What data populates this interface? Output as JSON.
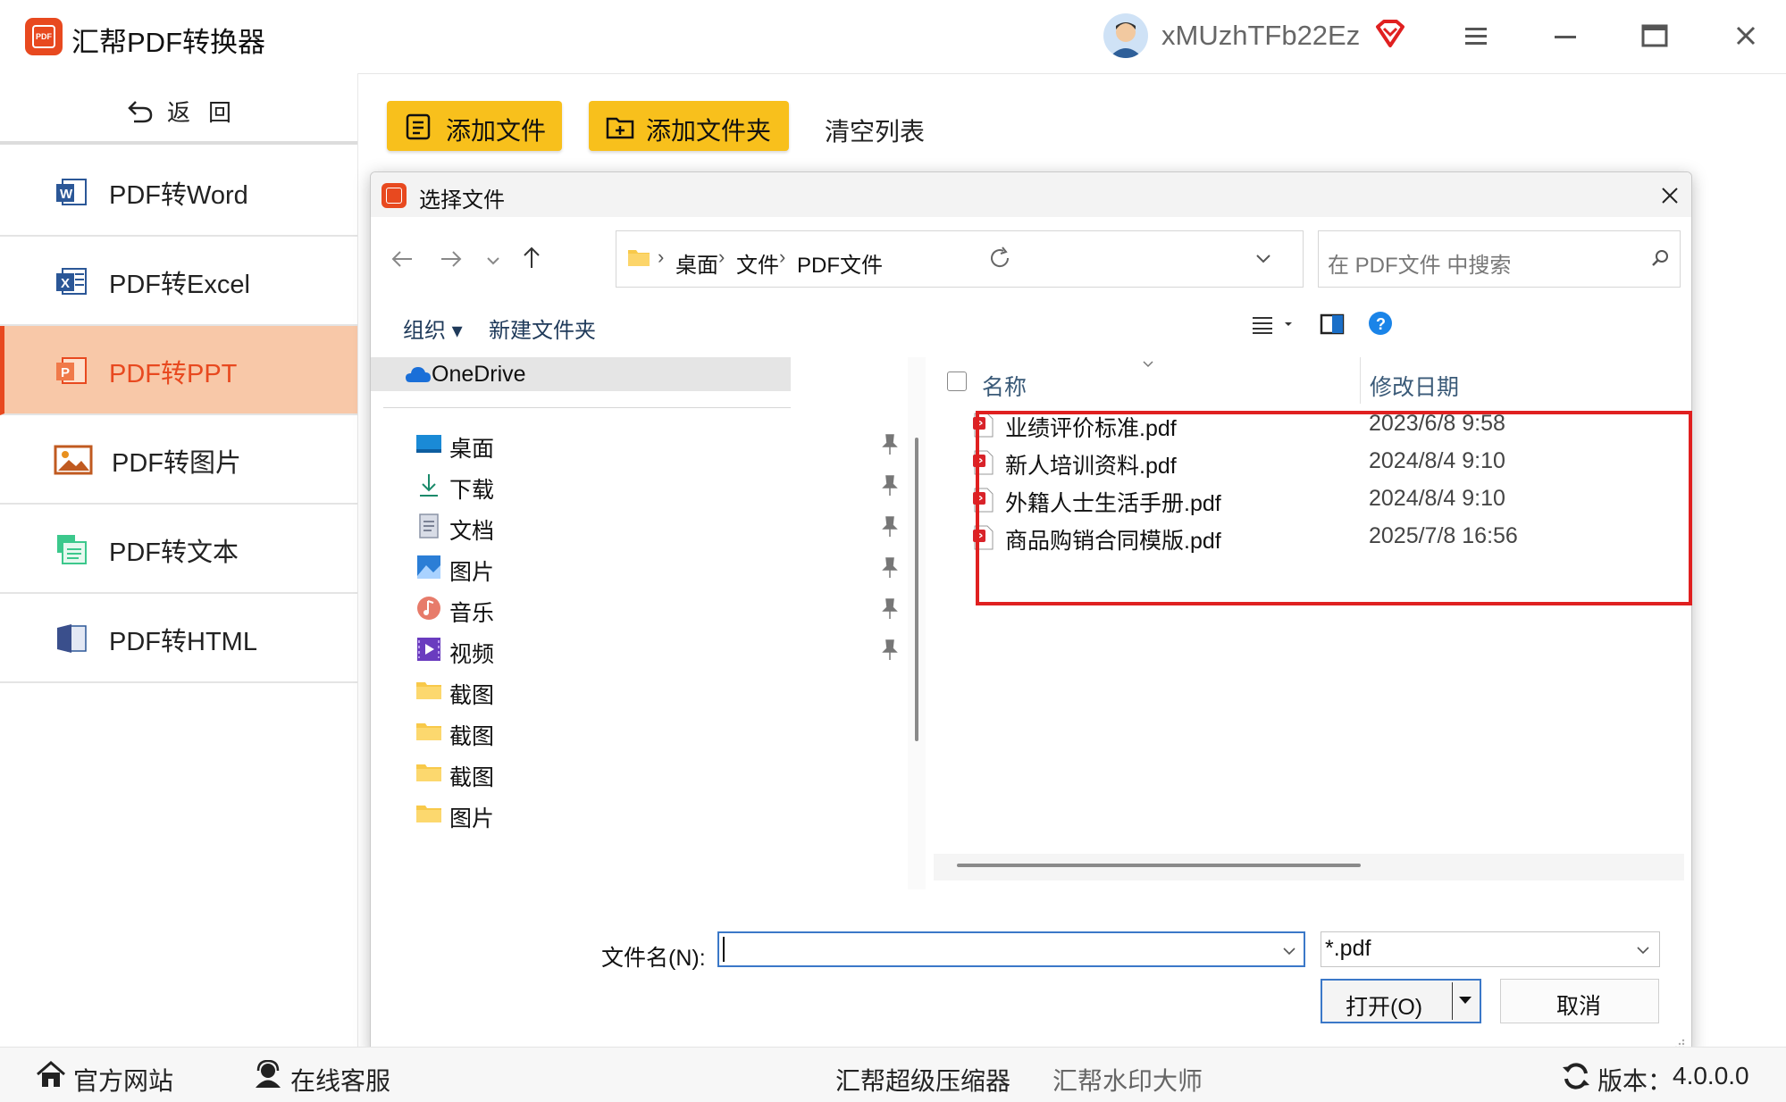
{
  "app": {
    "title": "汇帮PDF转换器",
    "logo_text": "PDF",
    "username": "xMUzhTFb22Ez",
    "accent_color": "#e8491f",
    "button_color": "#f8c01c",
    "highlight_color": "#e02020"
  },
  "sidebar": {
    "back_label": "返回",
    "items": [
      {
        "label": "PDF转Word",
        "icon": "word-icon",
        "active": false
      },
      {
        "label": "PDF转Excel",
        "icon": "excel-icon",
        "active": false
      },
      {
        "label": "PDF转PPT",
        "icon": "ppt-icon",
        "active": true
      },
      {
        "label": "PDF转图片",
        "icon": "image-icon",
        "active": false
      },
      {
        "label": "PDF转文本",
        "icon": "text-icon",
        "active": false
      },
      {
        "label": "PDF转HTML",
        "icon": "html-icon",
        "active": false
      }
    ]
  },
  "toolbar": {
    "add_file_label": "添加文件",
    "add_folder_label": "添加文件夹",
    "clear_list_label": "清空列表"
  },
  "dialog": {
    "title": "选择文件",
    "breadcrumb": [
      "桌面",
      "文件",
      "PDF文件"
    ],
    "search_placeholder": "在 PDF文件 中搜索",
    "organize_label": "组织",
    "new_folder_label": "新建文件夹",
    "tree": {
      "onedrive": "OneDrive",
      "quick_access": [
        {
          "label": "桌面",
          "icon": "desktop-icon",
          "pinned": true
        },
        {
          "label": "下载",
          "icon": "download-icon",
          "pinned": true
        },
        {
          "label": "文档",
          "icon": "document-icon",
          "pinned": true
        },
        {
          "label": "图片",
          "icon": "pictures-icon",
          "pinned": true
        },
        {
          "label": "音乐",
          "icon": "music-icon",
          "pinned": true
        },
        {
          "label": "视频",
          "icon": "video-icon",
          "pinned": true
        },
        {
          "label": "截图",
          "icon": "folder-icon",
          "pinned": false
        },
        {
          "label": "截图",
          "icon": "folder-icon",
          "pinned": false
        },
        {
          "label": "截图",
          "icon": "folder-icon",
          "pinned": false
        },
        {
          "label": "图片",
          "icon": "folder-icon",
          "pinned": false
        }
      ]
    },
    "columns": {
      "name": "名称",
      "modified": "修改日期"
    },
    "files": [
      {
        "name": "业绩评价标准.pdf",
        "modified": "2023/6/8 9:58"
      },
      {
        "name": "新人培训资料.pdf",
        "modified": "2024/8/4 9:10"
      },
      {
        "name": "外籍人士生活手册.pdf",
        "modified": "2024/8/4 9:10"
      },
      {
        "name": "商品购销合同模版.pdf",
        "modified": "2025/7/8 16:56"
      }
    ],
    "filename_label": "文件名(N):",
    "filename_value": "",
    "filetype_value": "*.pdf",
    "open_label": "打开(O)",
    "cancel_label": "取消"
  },
  "footer": {
    "website_label": "官方网站",
    "support_label": "在线客服",
    "compressor_label": "汇帮超级压缩器",
    "watermark_label": "汇帮水印大师",
    "version_label": "版本：",
    "version_value": "4.0.0.0"
  }
}
